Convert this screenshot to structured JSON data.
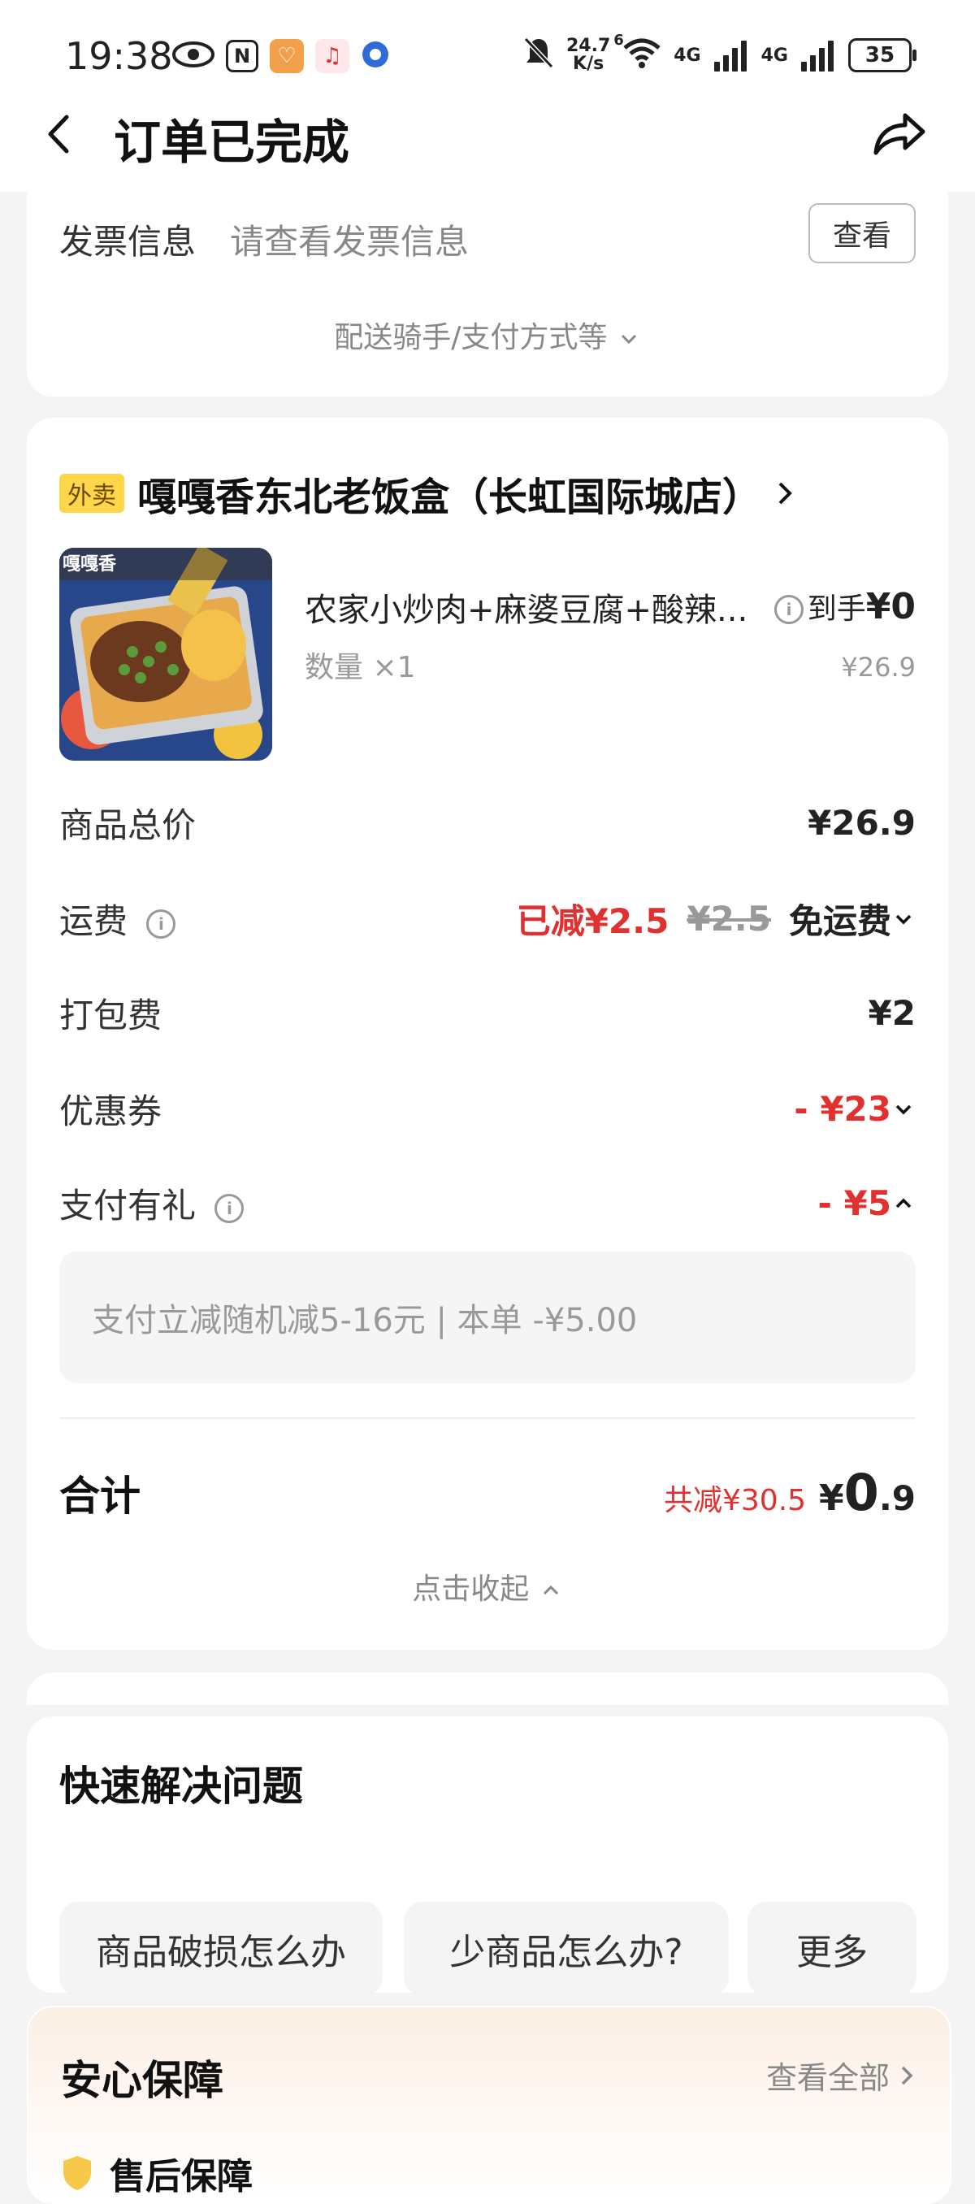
{
  "status_bar": {
    "time": "19:38",
    "speed_top": "24.7",
    "speed_bottom": "K/s",
    "wifi_label": "6",
    "net1": "4G",
    "net2": "4G",
    "battery": "35"
  },
  "nav": {
    "title": "订单已完成"
  },
  "invoice": {
    "label": "发票信息",
    "placeholder": "请查看发票信息",
    "view_button": "查看",
    "more_toggle": "配送骑手/支付方式等"
  },
  "store": {
    "badge": "外卖",
    "name": "嘎嘎香东北老饭盒（长虹国际城店）",
    "image_text": "嘎嘎香"
  },
  "item": {
    "name": "农家小炒肉+麻婆豆腐+酸辣...",
    "quantity": "数量 ×1",
    "net_label": "到手",
    "net_price": "¥0",
    "original_price": "¥26.9"
  },
  "summary": {
    "goods_total_label": "商品总价",
    "goods_total_value": "¥26.9",
    "shipping_label": "运费",
    "shipping_reduced": "已减¥2.5",
    "shipping_original": "¥2.5",
    "shipping_free": "免运费",
    "packing_label": "打包费",
    "packing_value": "¥2",
    "coupon_label": "优惠券",
    "coupon_value": "- ¥23",
    "pay_gift_label": "支付有礼",
    "pay_gift_value": "- ¥5",
    "pay_gift_detail": "支付立减随机减5-16元 | 本单 -¥5.00",
    "total_label": "合计",
    "total_saved": "共减¥30.5",
    "total_currency": "¥",
    "total_int": "0",
    "total_dec": ".9",
    "collapse": "点击收起"
  },
  "quick_help": {
    "title": "快速解决问题",
    "chips": [
      "商品破损怎么办",
      "少商品怎么办?",
      "更多"
    ]
  },
  "guarantee": {
    "title": "安心保障",
    "view_all": "查看全部",
    "first_item": "售后保障"
  },
  "colors": {
    "accent_red": "#e0302f",
    "badge_yellow": "#ffd54a"
  }
}
